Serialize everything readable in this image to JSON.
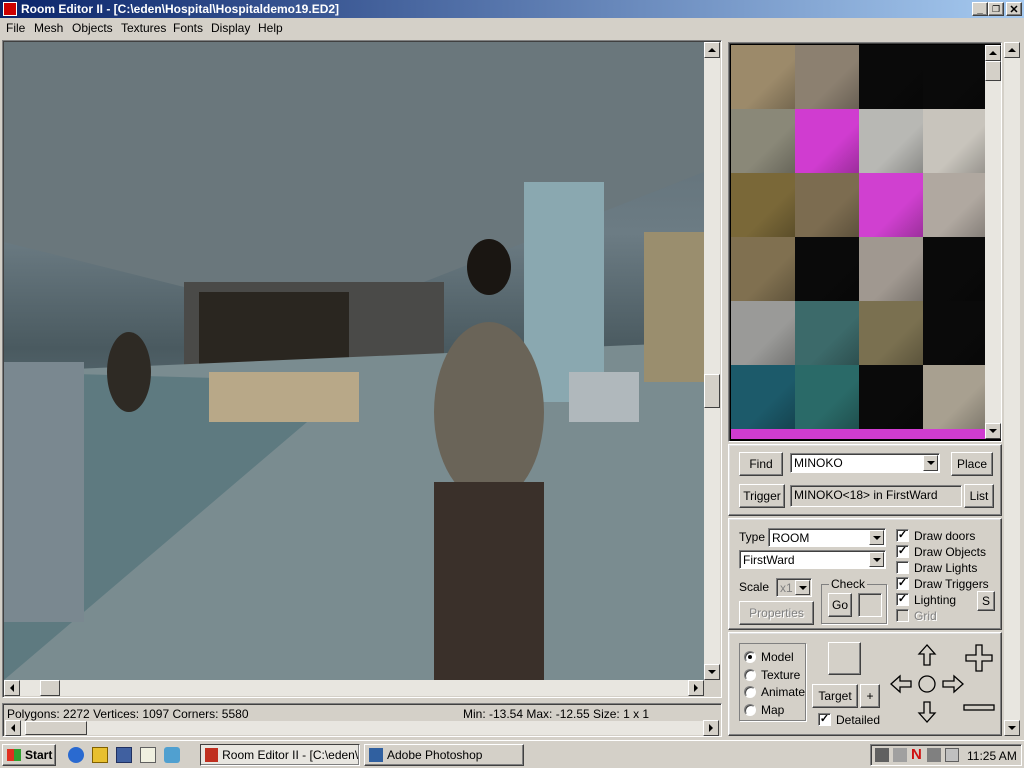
{
  "window": {
    "title": "Room Editor II - [C:\\eden\\Hospital\\Hospitaldemo19.ED2]"
  },
  "menu": [
    "File",
    "Mesh",
    "Objects",
    "Textures",
    "Fonts",
    "Display",
    "Help"
  ],
  "viewport": {
    "status": "Polygons: 2272  Vertices: 1097  Corners: 5580",
    "range": "Min: -13.54  Max: -12.55  Size: 1 x 1"
  },
  "texture_panel": {
    "swatches": [
      "#9c8a6a",
      "#8c8070",
      "#0a0a0a",
      "#0a0a0a",
      "#8a8878",
      "#d03cd0",
      "#b8b8b4",
      "#c8c4bc",
      "#7a6838",
      "#7c6c50",
      "#d040d0",
      "#b0a8a0",
      "#807050",
      "#0a0a0a",
      "#a09890",
      "#0a0a0a",
      "#9a9a98",
      "#3c6a6a",
      "#7a7050",
      "#0a0a0a",
      "#1c5a6a",
      "#2a6a68",
      "#0a0a0a",
      "#a8a090"
    ]
  },
  "find": {
    "find_label": "Find",
    "find_value": "MINOKO",
    "place_label": "Place",
    "trigger_label": "Trigger",
    "trigger_value": "MINOKO<18> in FirstWard",
    "list_label": "List"
  },
  "props": {
    "type_label": "Type",
    "type_value": "ROOM",
    "room_value": "FirstWard",
    "scale_label": "Scale",
    "scale_value": "x1",
    "check_label": "Check",
    "go_label": "Go",
    "properties_label": "Properties",
    "draw_doors": "Draw doors",
    "draw_objects": "Draw Objects",
    "draw_lights": "Draw Lights",
    "draw_triggers": "Draw Triggers",
    "lighting": "Lighting",
    "grid": "Grid",
    "s_label": "S"
  },
  "mode": {
    "model": "Model",
    "texture": "Texture",
    "animate": "Animate",
    "map": "Map",
    "target_label": "Target",
    "plus_label": "+",
    "detailed": "Detailed"
  },
  "taskbar": {
    "start": "Start",
    "task1": "Room Editor II - [C:\\eden\\...",
    "task2": "Adobe Photoshop",
    "clock": "11:25 AM"
  },
  "colors": {
    "title_start": "#0a246a",
    "title_end": "#a6caf0",
    "magenta": "#d03cd0"
  }
}
